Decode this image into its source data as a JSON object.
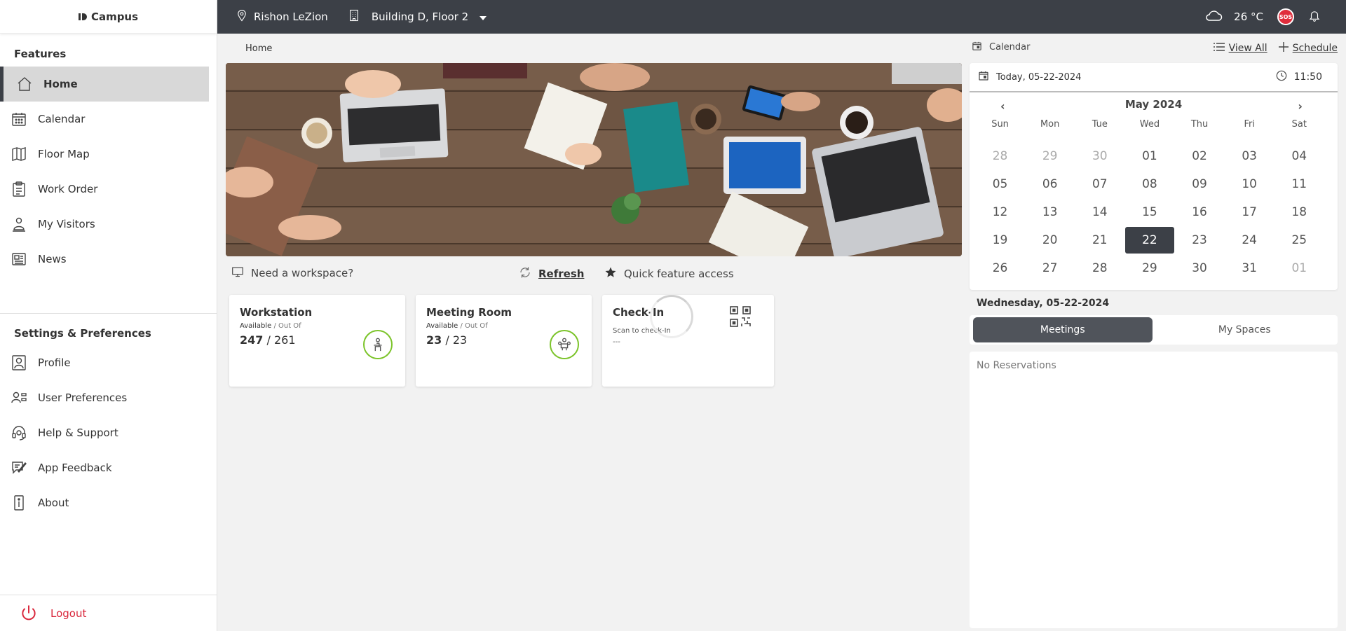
{
  "app": {
    "logo": "Campus"
  },
  "sidebar": {
    "features_title": "Features",
    "features": [
      {
        "label": "Home",
        "icon": "home-icon",
        "active": true
      },
      {
        "label": "Calendar",
        "icon": "calendar-icon"
      },
      {
        "label": "Floor Map",
        "icon": "map-icon"
      },
      {
        "label": "Work Order",
        "icon": "clipboard-icon"
      },
      {
        "label": "My Visitors",
        "icon": "visitors-icon"
      },
      {
        "label": "News",
        "icon": "news-icon"
      }
    ],
    "settings_title": "Settings & Preferences",
    "settings": [
      {
        "label": "Profile",
        "icon": "profile-icon"
      },
      {
        "label": "User Preferences",
        "icon": "user-preferences-icon"
      },
      {
        "label": "Help & Support",
        "icon": "headset-icon"
      },
      {
        "label": "App Feedback",
        "icon": "feedback-icon"
      },
      {
        "label": "About",
        "icon": "info-icon"
      }
    ],
    "logout": "Logout"
  },
  "topbar": {
    "location": "Rishon LeZion",
    "building": "Building D, Floor 2",
    "temperature": "26 °C",
    "sos": "SOS"
  },
  "main": {
    "breadcrumb": "Home",
    "workspace_prompt": "Need a workspace?",
    "refresh": "Refresh",
    "quick_access": "Quick feature access",
    "cards": {
      "workstation": {
        "title": "Workstation",
        "available": "Available",
        "out_of": "/ Out Of",
        "count": "247",
        "total": "/ 261"
      },
      "meeting_room": {
        "title": "Meeting Room",
        "available": "Available",
        "out_of": "/ Out Of",
        "count": "23",
        "total": "/ 23"
      },
      "checkin": {
        "title": "Check-In",
        "subtitle": "Scan to check-In",
        "value": "---"
      }
    }
  },
  "calendar": {
    "title": "Calendar",
    "view_all": "View All",
    "schedule": "Schedule",
    "today_label": "Today, 05-22-2024",
    "time": "11:50",
    "month": "May 2024",
    "weekdays": [
      "Sun",
      "Mon",
      "Tue",
      "Wed",
      "Thu",
      "Fri",
      "Sat"
    ],
    "weeks": [
      [
        "28",
        "29",
        "30",
        "01",
        "02",
        "03",
        "04"
      ],
      [
        "05",
        "06",
        "07",
        "08",
        "09",
        "10",
        "11"
      ],
      [
        "12",
        "13",
        "14",
        "15",
        "16",
        "17",
        "18"
      ],
      [
        "19",
        "20",
        "21",
        "22",
        "23",
        "24",
        "25"
      ],
      [
        "26",
        "27",
        "28",
        "29",
        "30",
        "31",
        "01"
      ]
    ],
    "selected_day": "22",
    "selected_date_label": "Wednesday, 05-22-2024",
    "tabs": [
      "Meetings",
      "My Spaces"
    ],
    "empty_text": "No Reservations"
  }
}
